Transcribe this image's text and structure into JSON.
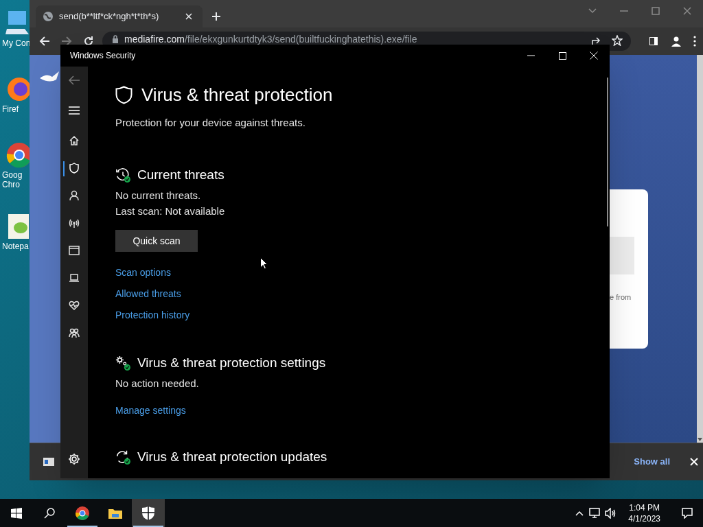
{
  "desktop_icons": [
    {
      "kind": "computer",
      "lines": [
        "My Con"
      ]
    },
    {
      "kind": "firefox",
      "lines": [
        "Firef"
      ]
    },
    {
      "kind": "chrome",
      "lines": [
        "Goog",
        "Chro"
      ]
    },
    {
      "kind": "notepad",
      "lines": [
        "Notepa"
      ]
    }
  ],
  "browser": {
    "tab_title": "send(b**ltf*ck*ngh*t*th*s)",
    "url_domain": "mediafire.com",
    "url_path": "/file/ekxgunkurtdtyk3/send(builtfuckinghatethis).exe/file",
    "page_snippet": "e from",
    "download_bar": {
      "show_all": "Show all"
    }
  },
  "security_window": {
    "title": "Windows Security",
    "nav": [
      {
        "selected": false
      },
      {
        "selected": true
      },
      {
        "selected": false
      },
      {
        "selected": false
      },
      {
        "selected": false
      },
      {
        "selected": false
      },
      {
        "selected": false
      },
      {
        "selected": false
      }
    ],
    "heading": "Virus & threat protection",
    "subtitle": "Protection for your device against threats.",
    "sections": [
      {
        "title": "Current threats",
        "lines": [
          "No current threats.",
          "Last scan: Not available"
        ],
        "button": "Quick scan",
        "links": [
          "Scan options",
          "Allowed threats",
          "Protection history"
        ]
      },
      {
        "title": "Virus & threat protection settings",
        "lines": [
          "No action needed."
        ],
        "links": [
          "Manage settings"
        ]
      },
      {
        "title": "Virus & threat protection updates"
      }
    ]
  },
  "taskbar": {
    "apps": [
      {
        "kind": "chrome",
        "running": true,
        "selected": false
      },
      {
        "kind": "explorer",
        "running": false,
        "selected": false
      },
      {
        "kind": "security",
        "running": true,
        "selected": true
      }
    ],
    "time": "1:04 PM",
    "date": "4/1/2023"
  }
}
